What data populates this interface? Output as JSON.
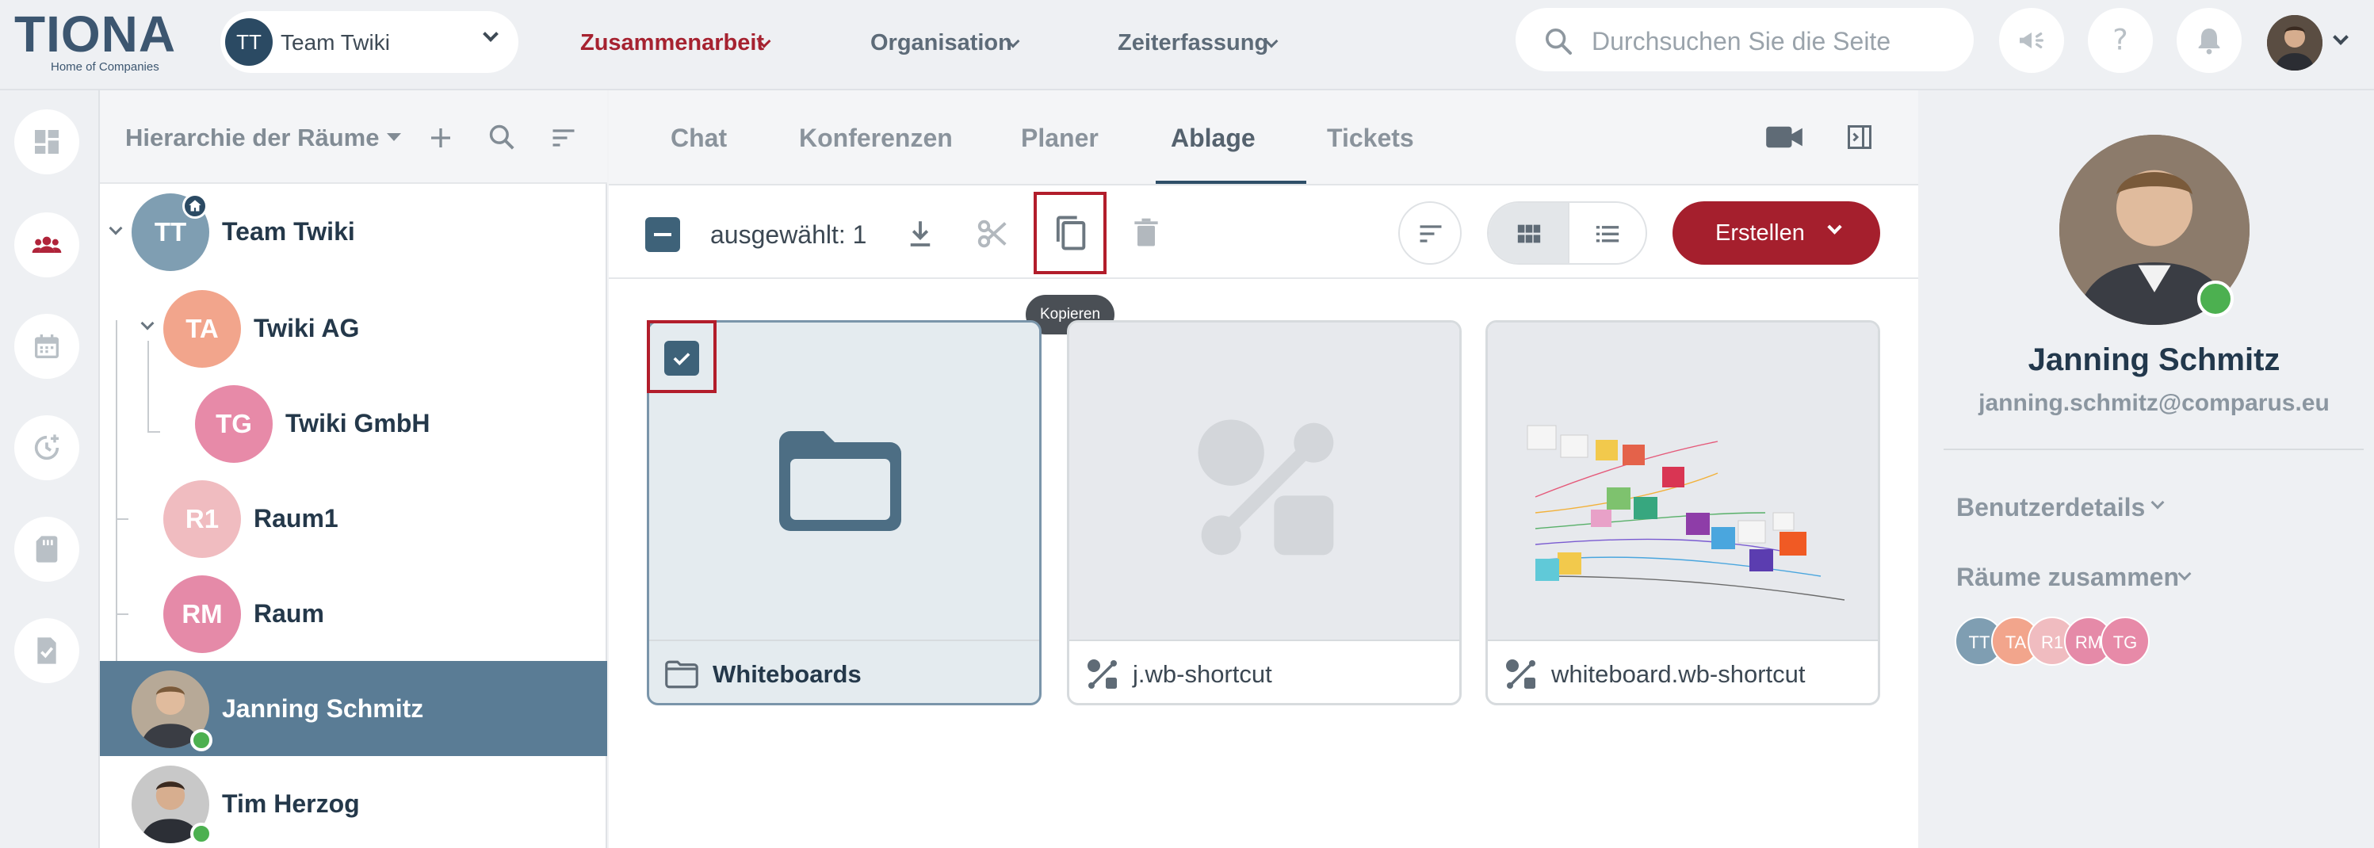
{
  "brand": {
    "name": "TIONA",
    "tagline": "Home of Companies"
  },
  "team_selector": {
    "initials": "TT",
    "label": "Team Twiki"
  },
  "nav": [
    {
      "label": "Zusammenarbeit"
    },
    {
      "label": "Organisation"
    },
    {
      "label": "Zeiterfassung"
    }
  ],
  "search": {
    "placeholder": "Durchsuchen Sie die Seite"
  },
  "hierarchy": {
    "title": "Hierarchie der Räume",
    "items": [
      {
        "initials": "TT",
        "label": "Team Twiki",
        "color": "#7f9eb2"
      },
      {
        "initials": "TA",
        "label": "Twiki AG",
        "color": "#f2a58c"
      },
      {
        "initials": "TG",
        "label": "Twiki GmbH",
        "color": "#e78aa8"
      },
      {
        "initials": "R1",
        "label": "Raum1",
        "color": "#f0bcc0"
      },
      {
        "initials": "RM",
        "label": "Raum",
        "color": "#e58aa8"
      }
    ],
    "people": [
      {
        "label": "Janning Schmitz",
        "selected": true
      },
      {
        "label": "Tim Herzog",
        "selected": false
      }
    ]
  },
  "tabs": [
    {
      "label": "Chat"
    },
    {
      "label": "Konferenzen"
    },
    {
      "label": "Planer"
    },
    {
      "label": "Ablage",
      "active": true
    },
    {
      "label": "Tickets"
    }
  ],
  "toolbar": {
    "selected_text": "ausgewählt: 1",
    "create_label": "Erstellen",
    "copy_tooltip": "Kopieren"
  },
  "files": [
    {
      "name": "Whiteboards",
      "type": "folder",
      "selected": true
    },
    {
      "name": "j.wb-shortcut",
      "type": "shortcut",
      "selected": false
    },
    {
      "name": "whiteboard.wb-shortcut",
      "type": "shortcut",
      "selected": false
    }
  ],
  "profile": {
    "name": "Janning Schmitz",
    "email": "janning.schmitz@comparus.eu",
    "details_label": "Benutzerdetails",
    "rooms_label": "Räume zusammen",
    "rooms": [
      "TT",
      "TA",
      "R1",
      "RM",
      "TG"
    ]
  },
  "colors": {
    "accent": "#a62230",
    "primary": "#2e4f68",
    "online": "#4cb050"
  }
}
